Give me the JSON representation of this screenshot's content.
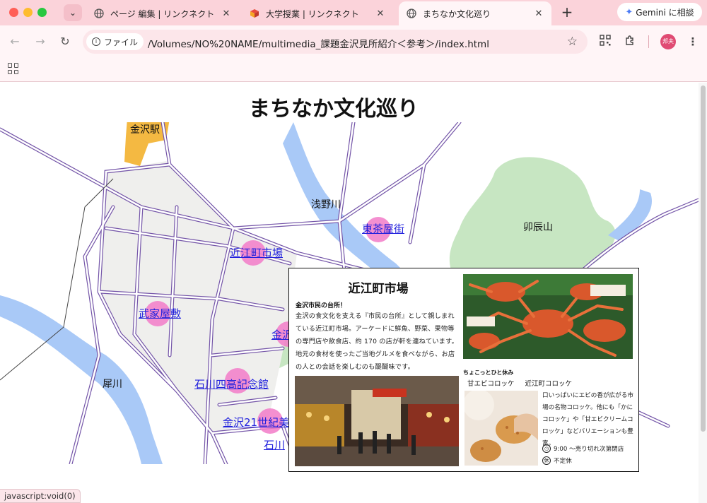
{
  "browser": {
    "tabs": [
      {
        "title": "ページ 編集 | リンクネクト",
        "active": false
      },
      {
        "title": "大学授業 | リンクネクト",
        "active": false
      },
      {
        "title": "まちなか文化巡り",
        "active": true
      }
    ],
    "new_tab_symbol": "+",
    "gemini_label": "Gemini に相談",
    "omnibox": {
      "chip_label": "ファイル",
      "url": "/Volumes/NO%20NAME/multimedia_課題金沢見所紹介＜参考＞/index.html"
    },
    "avatar_text": "邦夫",
    "status_text": "javascript:void(0)"
  },
  "page": {
    "title": "まちなか文化巡り",
    "map": {
      "labels": {
        "station": "金沢駅",
        "river_asano": "浅野川",
        "mountain": "卯辰山",
        "river_sai": "犀川"
      },
      "spots": {
        "higashi": "東茶屋街",
        "omicho": "近江町市場",
        "bukeyashiki": "武家屋敷",
        "kenroku": "金沢",
        "shiko": "石川四高記念館",
        "museum21": "金沢21世紀美",
        "ishikawa": "石川"
      }
    },
    "card": {
      "title": "近江町市場",
      "subtitle": "金沢市民の台所！",
      "body": "金沢の食文化を支える『市民の台所』として親しまれている近江町市場。アーケードに鮮魚、野菜、果物等の専門店や飲食店、約 170 の店が軒を連ねています。地元の食材を使ったご当地グルメを食べながら、お店の人との会話を楽しむのも醍醐味です。",
      "break_heading": "ちょこっとひと休み",
      "break_item": "甘エビコロッケ",
      "break_shop": "近江町コロッケ",
      "break_body": "口いっぱいにエビの香が広がる市場の名物コロッケ。他にも「かにコロッケ」や「甘エビクリームコロッケ」などバリエーションも豊富。",
      "hours": "9:00 ～売り切れ次第閉店",
      "closed_icon": "休",
      "closed": "不定休"
    }
  },
  "colors": {
    "chrome": "#fbd3da",
    "link": "#2222dd",
    "spot": "#f27bc8",
    "river": "#a9c9f7",
    "green": "#c7e6c2",
    "block": "#efefed",
    "station": "#f4b942"
  }
}
